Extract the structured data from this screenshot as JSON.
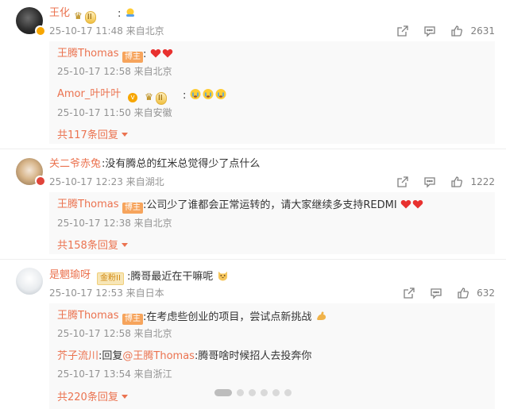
{
  "colors": {
    "accent": "#eb7350",
    "meta": "#939393",
    "text": "#333333",
    "panel": "#f9f9f9"
  },
  "comments": [
    {
      "user": "王化",
      "medal_text": "II",
      "text": ":",
      "emoji": "hug-emoji",
      "meta": "25-10-17 11:48 来自北京",
      "likes": "2631",
      "replies": [
        {
          "user": "王腾Thomas",
          "tag": "博主",
          "text": ":",
          "emoji": "two-hearts",
          "meta": "25-10-17 12:58 来自北京"
        },
        {
          "user": "Amor_叶叶叶",
          "medal_text": "II",
          "text": ":",
          "emoji": "three-crying",
          "meta": "25-10-17 11:50 来自安徽"
        }
      ],
      "more": "共117条回复"
    },
    {
      "user": "关二爷赤兔",
      "text": ":没有腾总的红米总觉得少了点什么",
      "meta": "25-10-17 12:23 来自湖北",
      "likes": "1222",
      "replies": [
        {
          "user": "王腾Thomas",
          "tag": "博主",
          "text": ":公司少了谁都会正常运转的，请大家继续多支持REDMI",
          "emoji": "two-hearts",
          "meta": "25-10-17 12:38 来自北京"
        }
      ],
      "more": "共158条回复"
    },
    {
      "user": "是魍瑜呀",
      "tag": "金粉II",
      "text": ":腾哥最近在干嘛呢",
      "emoji": "cat-face",
      "meta": "25-10-17 12:53 来自日本",
      "likes": "632",
      "replies": [
        {
          "user": "王腾Thomas",
          "tag": "博主",
          "text": ":在考虑些创业的项目，尝试点新挑战",
          "emoji": "strong-arm",
          "meta": "25-10-17 12:58 来自北京"
        },
        {
          "user": "芥子流川",
          "reply_prefix": ":回复",
          "reply_to": "@王腾Thomas",
          "text": ":腾哥啥时候招人去投奔你",
          "meta": "25-10-17 13:54 来自浙江"
        }
      ],
      "more": "共220条回复"
    }
  ]
}
